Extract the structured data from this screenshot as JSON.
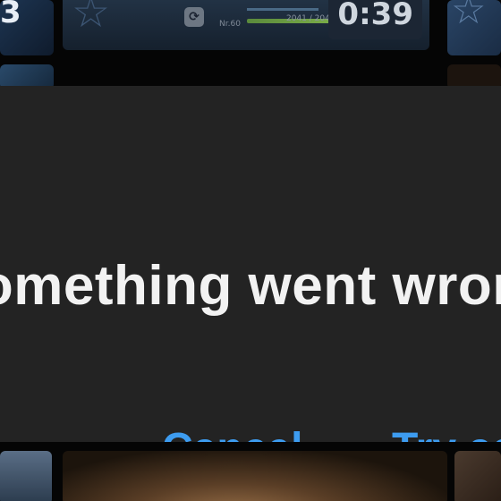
{
  "background": {
    "tile_number": "3",
    "progress_label": "Nr.60",
    "score_text": "2041 / 2041",
    "timer": "0:39"
  },
  "dialog": {
    "title": "Something went wrong",
    "cancel_label": "Cancel",
    "retry_label": "Try again"
  },
  "colors": {
    "dialog_bg": "#232323",
    "title_text": "#f2f2f2",
    "button_text": "#3d9cf0"
  }
}
